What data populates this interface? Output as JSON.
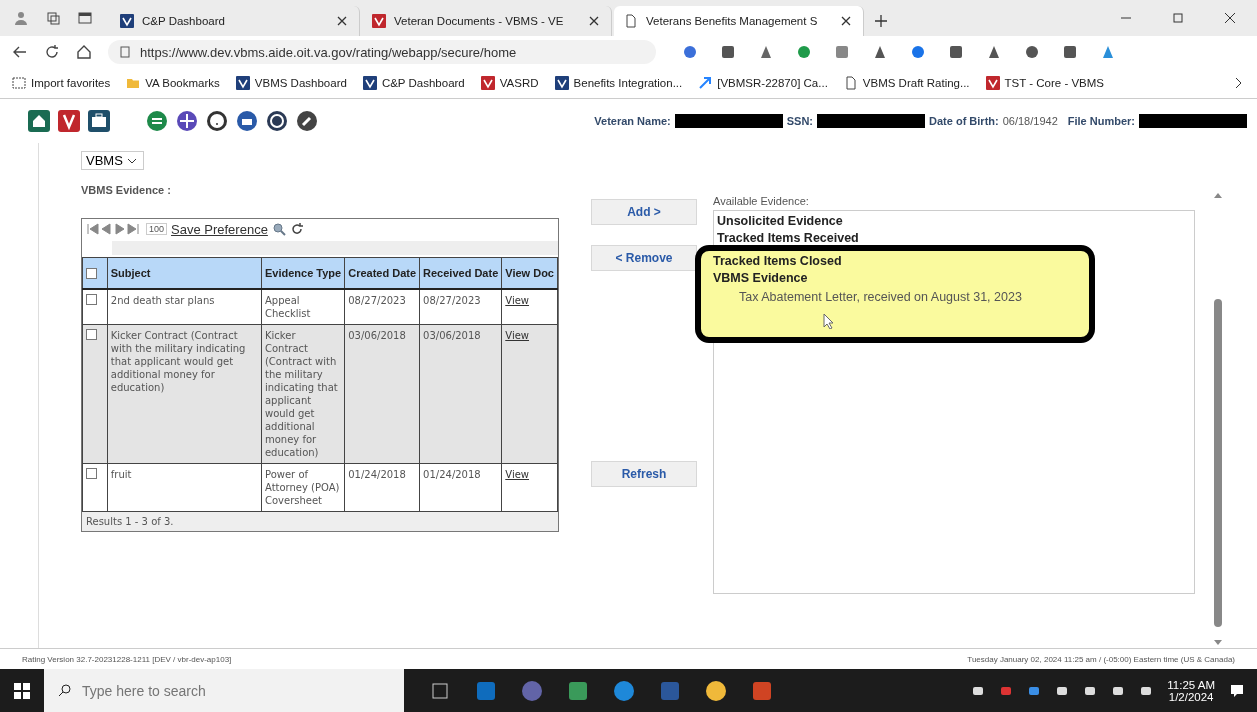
{
  "browser": {
    "tabs": [
      {
        "title": "C&P Dashboard",
        "selected": false
      },
      {
        "title": "Veteran Documents - VBMS - VE",
        "selected": false
      },
      {
        "title": "Veterans Benefits Management S",
        "selected": true
      }
    ],
    "url": "https://www.dev.vbms.aide.oit.va.gov/rating/webapp/secure/home",
    "bookmarks": [
      {
        "label": "Import favorites"
      },
      {
        "label": "VA Bookmarks"
      },
      {
        "label": "VBMS Dashboard"
      },
      {
        "label": "C&P Dashboard"
      },
      {
        "label": "VASRD"
      },
      {
        "label": "Benefits Integration..."
      },
      {
        "label": "[VBMSR-22870] Ca..."
      },
      {
        "label": "VBMS Draft Rating..."
      },
      {
        "label": "TST - Core - VBMS"
      }
    ]
  },
  "veteran": [
    {
      "label": "Veteran Name:",
      "redacted": true
    },
    {
      "label": "SSN:",
      "redacted": true
    },
    {
      "label": "Date of Birth:",
      "value": "06/18/1942",
      "redacted": false
    },
    {
      "label": "File Number:",
      "redacted": true
    }
  ],
  "source_select": "VBMS",
  "evidence_label": "VBMS Evidence :",
  "table": {
    "page_size": "100",
    "save_link": "Save Preference",
    "header_checked": false,
    "columns": [
      "Subject",
      "Evidence Type",
      "Created Date",
      "Received Date",
      "View Doc"
    ],
    "rows": [
      {
        "checked": false,
        "subject": "2nd death star plans",
        "evidence_type": "Appeal Checklist",
        "created": "08/27/2023",
        "received": "08/27/2023",
        "view": "View"
      },
      {
        "checked": false,
        "subject": "Kicker Contract (Contract with the military indicating that applicant would get additional money for education)",
        "evidence_type": "Kicker Contract (Contract with the military indicating that applicant would get additional money for education)",
        "created": "03/06/2018",
        "received": "03/06/2018",
        "view": "View"
      },
      {
        "checked": false,
        "subject": "fruit",
        "evidence_type": "Power of Attorney (POA) Coversheet",
        "created": "01/24/2018",
        "received": "01/24/2018",
        "view": "View"
      }
    ],
    "results": "Results 1 - 3 of 3."
  },
  "buttons": {
    "add": "Add >",
    "remove": "< Remove",
    "refresh": "Refresh"
  },
  "available_evidence": {
    "label": "Available Evidence:",
    "items": [
      {
        "kind": "group",
        "text": "Unsolicited Evidence"
      },
      {
        "kind": "group",
        "text": "Tracked Items Received"
      }
    ],
    "highlight_items": [
      {
        "kind": "group",
        "text": "Tracked Items Closed"
      },
      {
        "kind": "group",
        "text": "VBMS Evidence"
      },
      {
        "kind": "item",
        "text": "Tax Abatement Letter, received on August 31, 2023"
      }
    ]
  },
  "status_bar": {
    "version": "Rating Version 32.7-20231228-1211 [DEV / vbr-dev-ap103]",
    "time": "Tuesday January 02, 2024 11:25 am / (-05:00) Eastern time (US & Canada)"
  },
  "taskbar": {
    "search_placeholder": "Type here to search",
    "time": "11:25 AM",
    "date": "1/2/2024"
  }
}
